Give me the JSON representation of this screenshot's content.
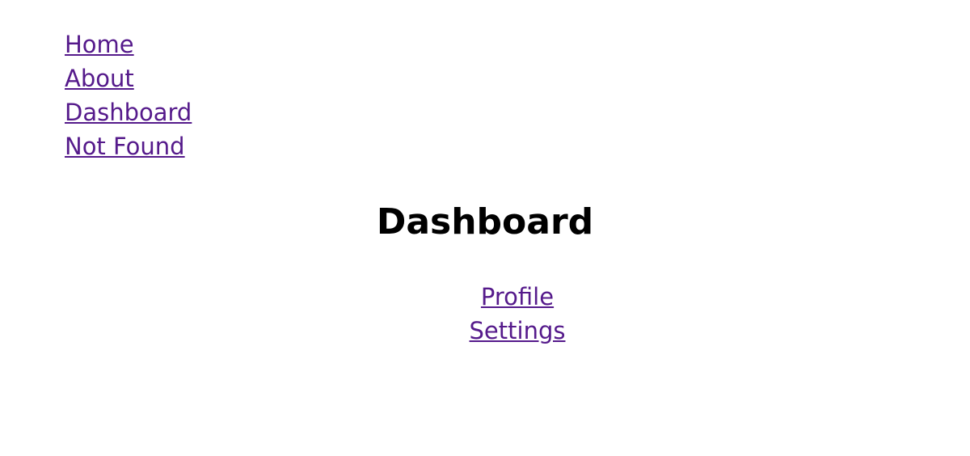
{
  "nav": {
    "items": [
      {
        "label": "Home"
      },
      {
        "label": "About"
      },
      {
        "label": "Dashboard"
      },
      {
        "label": "Not Found"
      }
    ]
  },
  "main": {
    "title": "Dashboard",
    "subnav": {
      "items": [
        {
          "label": "Profile"
        },
        {
          "label": "Settings"
        }
      ]
    }
  },
  "colors": {
    "link": "#551a8b",
    "text": "#000000",
    "background": "#ffffff"
  }
}
